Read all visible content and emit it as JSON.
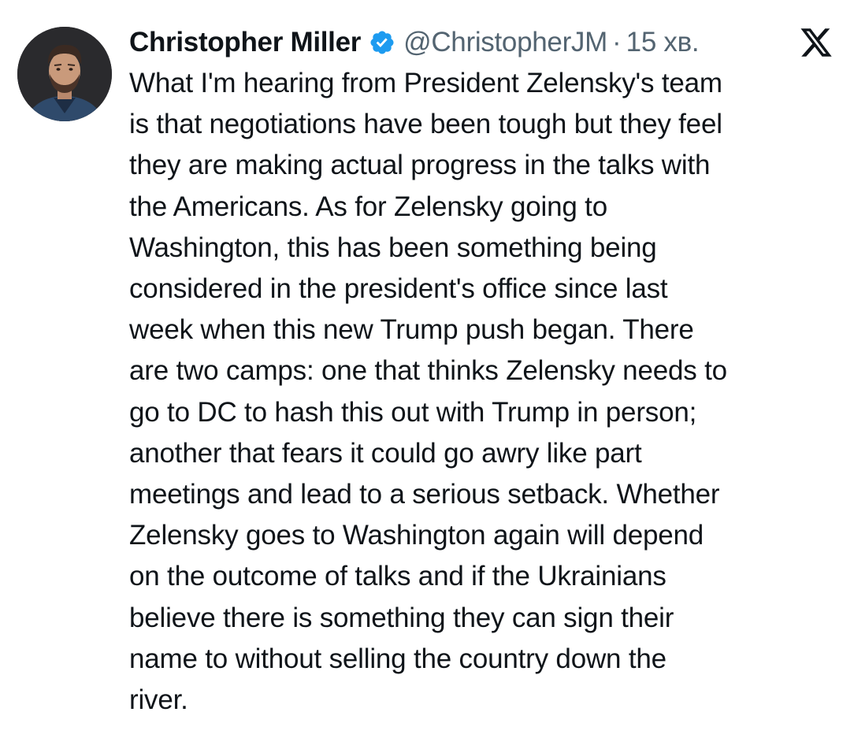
{
  "author": {
    "name": "Christopher Miller",
    "handle": "@ChristopherJM",
    "separator": "·",
    "time": "15 хв.",
    "verified_color": "#1d9bf0"
  },
  "icons": {
    "avatar": "profile-photo",
    "verified": "verified-badge-icon",
    "platform": "x-logo-icon"
  },
  "tweet": {
    "lines": [
      "What I'm hearing from President Zelensky's team",
      "is that negotiations have been tough but they feel",
      "they are making actual progress in the talks with",
      "the Americans. As for Zelensky going to",
      "Washington, this has been something being",
      "considered in the president's office since last",
      "week when this new Trump push began. There",
      "are two camps: one that thinks Zelensky needs to",
      "go to DC to hash this out with Trump in person;",
      "another that fears it could go awry like part",
      "meetings and lead to a serious setback. Whether",
      "Zelensky goes to Washington again will depend",
      "on the outcome of talks and if the Ukrainians",
      "believe there is something they can sign their",
      "name to without selling the country down the",
      "river."
    ]
  }
}
